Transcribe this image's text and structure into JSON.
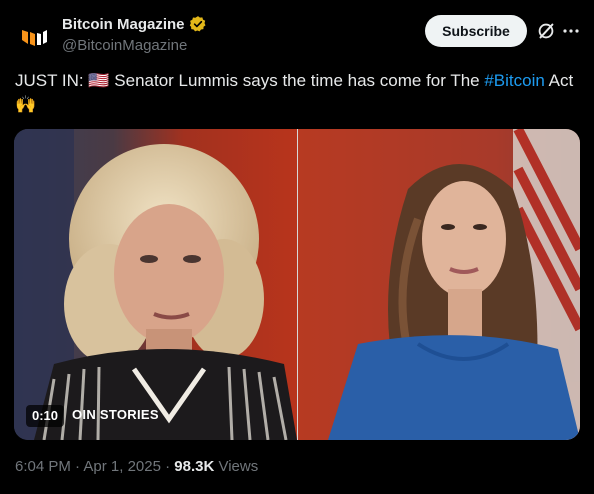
{
  "account": {
    "name": "Bitcoin Magazine",
    "handle": "@BitcoinMagazine",
    "verified_color": "#e2b719"
  },
  "actions": {
    "subscribe_label": "Subscribe",
    "grok_icon": "grok-icon",
    "more_icon": "more-icon"
  },
  "tweet": {
    "prefix": "JUST IN: ",
    "flag": "🇺🇸",
    "text_before_tag": " Senator Lummis says the time has come for The ",
    "hashtag": "#Bitcoin",
    "text_after_tag": " Act ",
    "emoji": "🙌"
  },
  "video": {
    "timestamp": "0:10",
    "watermark": "OIN STORIES"
  },
  "meta": {
    "time": "6:04 PM",
    "separator": " · ",
    "date": "Apr 1, 2025",
    "views_count": "98.3K",
    "views_label": " Views"
  },
  "colors": {
    "background": "#000000",
    "link": "#1d9bf0",
    "muted": "#71767b",
    "brand": "#f7931a"
  }
}
